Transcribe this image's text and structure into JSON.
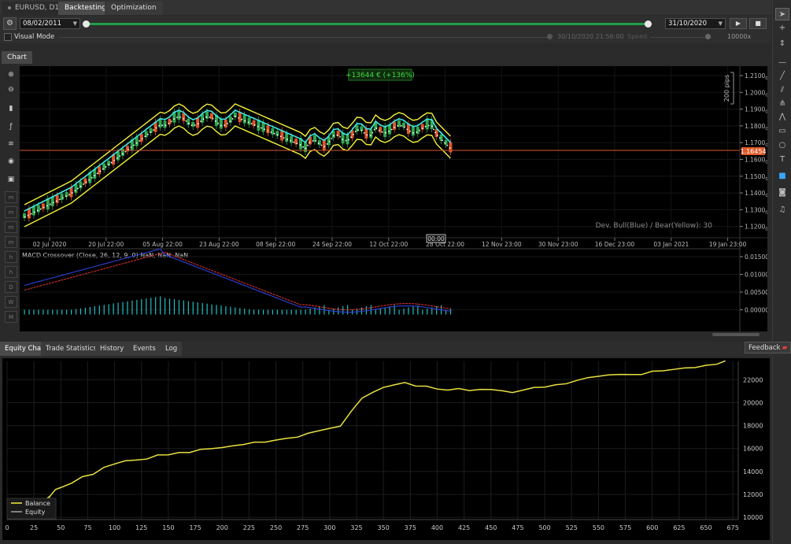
{
  "top_tabs": {
    "symbol": "EURUSD, D1",
    "backtesting": "Backtesting",
    "optimization": "Optimization"
  },
  "controls": {
    "start_date": "08/02/2011",
    "end_date": "31/10/2020",
    "visual_mode_label": "Visual Mode",
    "visual_time": "30/10/2020 21:56:00",
    "speed_label": "Speed",
    "speed_value": "10000x"
  },
  "chart_tab": "Chart",
  "price_chart": {
    "profit_badge": "+13644 € (+136%)",
    "scale_label": "200 pips",
    "current_price": "1.16454",
    "indicator_note": "Dev. Bull(Blue) / Bear(Yellow):  30",
    "price_ticks": [
      "1.2100",
      "1.2000",
      "1.1900",
      "1.1800",
      "1.1700",
      "1.1600",
      "1.1500",
      "1.1400",
      "1.1300",
      "1.1200"
    ],
    "price_tick_subscripts": [
      "0",
      "0",
      "0",
      "0",
      "0",
      "0",
      "0",
      "0",
      "0",
      "0"
    ],
    "date_ticks": [
      "02 Jul 2020",
      "20 Jul 22:00",
      "05 Aug 22:00",
      "23 Aug 22:00",
      "08 Sep 22:00",
      "24 Sep 22:00",
      "12 Oct 22:00",
      "28 Oct 22:00",
      "12 Nov 23:00",
      "30 Nov 23:00",
      "16 Dec 23:00",
      "03 Jan 2021",
      "19 Jan 23:00"
    ],
    "cursor_time": "00:00",
    "macd_label": "MACD Crossover (Close, 26, 12, 9, 0) NaN, NaN, NaN",
    "macd_ticks": [
      "0.01500",
      "0.01000",
      "0.00500",
      "0.00000"
    ]
  },
  "left_toolbar": {
    "timeframes": [
      "m",
      "m",
      "m",
      "m",
      "h",
      "h",
      "D",
      "W",
      "M"
    ]
  },
  "bottom_tabs": {
    "equity_chart": "Equity Chart",
    "trade_statistics": "Trade Statistics",
    "history": "History",
    "events": "Events",
    "log": "Log",
    "feedback": "Feedback"
  },
  "chart_data": {
    "type": "line",
    "title": "",
    "xlabel": "",
    "ylabel": "",
    "x_ticks": [
      0,
      25,
      50,
      75,
      100,
      125,
      150,
      175,
      200,
      225,
      250,
      275,
      300,
      325,
      350,
      375,
      400,
      425,
      450,
      475,
      500,
      525,
      550,
      575,
      600,
      625,
      650,
      675
    ],
    "y_ticks": [
      10000,
      12000,
      14000,
      16000,
      18000,
      20000,
      22000
    ],
    "xlim": [
      0,
      680
    ],
    "ylim": [
      9800,
      23600
    ],
    "legend_position": "bottom-left",
    "grid": true,
    "series": [
      {
        "name": "Balance",
        "color": "#e8e040",
        "x": [
          0,
          10,
          20,
          25,
          30,
          40,
          45,
          50,
          60,
          70,
          80,
          90,
          100,
          110,
          120,
          130,
          140,
          150,
          160,
          170,
          180,
          190,
          200,
          210,
          220,
          230,
          240,
          250,
          260,
          270,
          280,
          290,
          300,
          310,
          320,
          330,
          340,
          350,
          360,
          370,
          380,
          390,
          400,
          410,
          420,
          430,
          440,
          450,
          460,
          470,
          480,
          490,
          500,
          510,
          520,
          530,
          540,
          550,
          560,
          570,
          580,
          590,
          600,
          610,
          620,
          630,
          640,
          650,
          660,
          668
        ],
        "values": [
          10100,
          10200,
          10350,
          10600,
          11100,
          11900,
          12400,
          12600,
          13000,
          13500,
          13800,
          14300,
          14700,
          14900,
          15000,
          15100,
          15400,
          15500,
          15600,
          15700,
          15900,
          16000,
          16100,
          16200,
          16400,
          16500,
          16600,
          16700,
          16900,
          17000,
          17300,
          17600,
          17700,
          18000,
          19200,
          20400,
          20900,
          21300,
          21600,
          21700,
          21500,
          21400,
          21200,
          21100,
          21200,
          21100,
          21100,
          21200,
          21000,
          20900,
          21100,
          21300,
          21400,
          21500,
          21700,
          21900,
          22200,
          22300,
          22400,
          22500,
          22400,
          22500,
          22700,
          22800,
          22900,
          23000,
          23100,
          23200,
          23400,
          23600
        ]
      },
      {
        "name": "Equity",
        "color": "#9a9a9a",
        "x": [
          0,
          10,
          20,
          25,
          30,
          40
        ],
        "values": [
          10100,
          10150,
          10300,
          10600,
          11000,
          11800
        ]
      }
    ]
  }
}
